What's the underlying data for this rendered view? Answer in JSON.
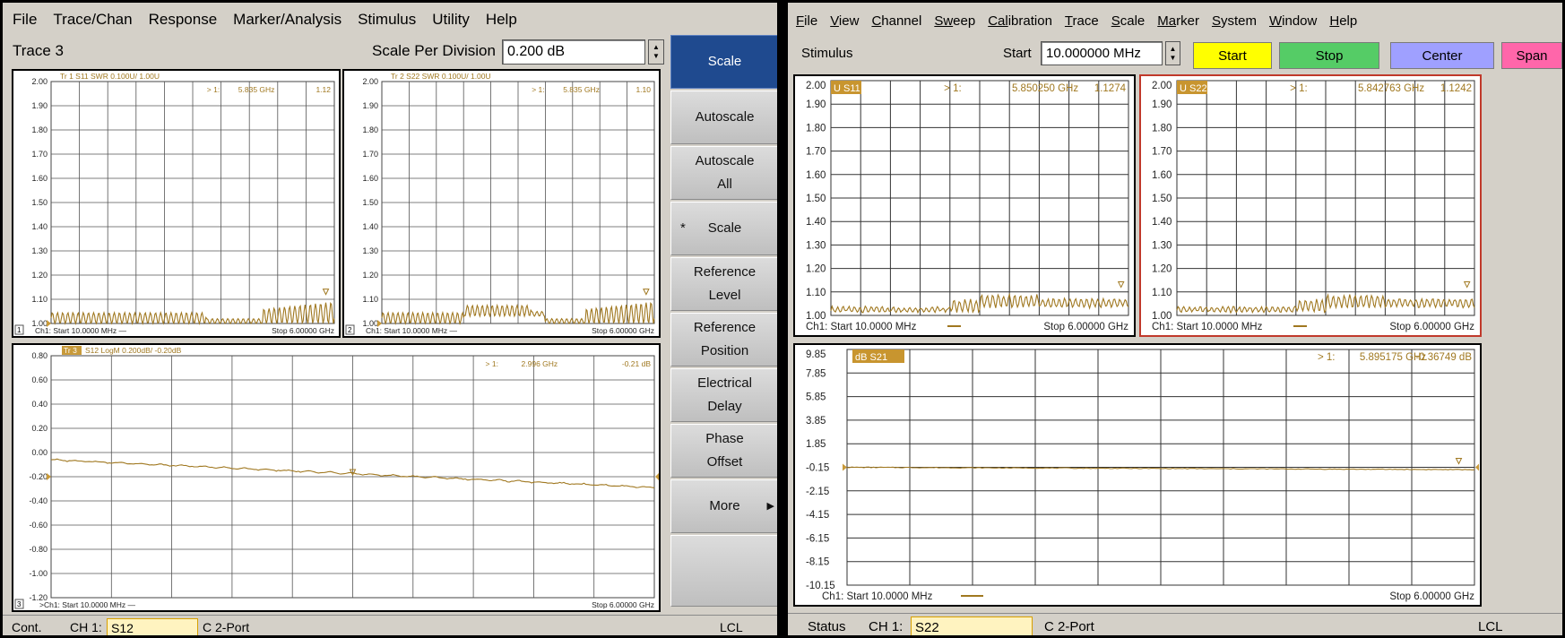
{
  "left": {
    "menu": [
      "File",
      "Trace/Chan",
      "Response",
      "Marker/Analysis",
      "Stimulus",
      "Utility",
      "Help"
    ],
    "active_trace": "Trace 3",
    "scale_label": "Scale Per Division",
    "scale_value": "0.200 dB",
    "softkeys": [
      "Scale",
      "Autoscale",
      "Autoscale|All",
      "Scale",
      "Reference|Level",
      "Reference|Position",
      "Electrical|Delay",
      "Phase|Offset",
      "More",
      ""
    ],
    "status": {
      "mode": "Cont.",
      "channel_label": "CH 1:",
      "param": "S12",
      "port": "C 2-Port",
      "lcl": "LCL"
    },
    "plots": [
      {
        "num": "1",
        "header": "Tr 1  S11 SWR 0.100U/ 1.00U",
        "marker_label": "> 1:",
        "marker_freq": "5.835 GHz",
        "marker_val": "1.12",
        "yticks": [
          "2.00",
          "1.90",
          "1.80",
          "1.70",
          "1.60",
          "1.50",
          "1.40",
          "1.30",
          "1.20",
          "1.10",
          "1.00"
        ],
        "footer_start": "Ch1: Start  10.0000 MHz —",
        "footer_stop": "Stop  6.00000 GHz"
      },
      {
        "num": "2",
        "header": "Tr 2  S22 SWR 0.100U/ 1.00U",
        "marker_label": "> 1:",
        "marker_freq": "5.835 GHz",
        "marker_val": "1.10",
        "yticks": [
          "2.00",
          "1.90",
          "1.80",
          "1.70",
          "1.60",
          "1.50",
          "1.40",
          "1.30",
          "1.20",
          "1.10",
          "1.00"
        ],
        "footer_start": "Ch1: Start  10.0000 MHz —",
        "footer_stop": "Stop  6.00000 GHz"
      },
      {
        "num": "3",
        "tr_tag": "Tr 3",
        "header": "S12 LogM 0.200dB/ -0.20dB",
        "marker_label": "> 1:",
        "marker_freq": "2.996 GHz",
        "marker_val": "-0.21 dB",
        "yticks": [
          "0.80",
          "0.60",
          "0.40",
          "0.20",
          "0.00",
          "-0.20",
          "-0.40",
          "-0.60",
          "-0.80",
          "-1.00",
          "-1.20"
        ],
        "footer_start": ">Ch1: Start  10.0000 MHz —",
        "footer_stop": "Stop  6.00000 GHz"
      }
    ]
  },
  "right": {
    "menu": [
      [
        "F",
        "ile"
      ],
      [
        "V",
        "iew"
      ],
      [
        "C",
        "hannel"
      ],
      [
        "Sw",
        "eep"
      ],
      [
        "Cal",
        "ibration"
      ],
      [
        "T",
        "race"
      ],
      [
        "S",
        "cale"
      ],
      [
        "Ma",
        "rker"
      ],
      [
        "S",
        "ystem"
      ],
      [
        "W",
        "indow"
      ],
      [
        "H",
        "elp"
      ]
    ],
    "stimulus_label": "Stimulus",
    "start_label": "Start",
    "start_value": "10.000000 MHz",
    "buttons": [
      "Start",
      "Stop",
      "Center",
      "Span"
    ],
    "button_colors": [
      "#ffff00",
      "#55cc66",
      "#9fa0ff",
      "#ff66aa"
    ],
    "status": {
      "label": "Status",
      "channel_label": "CH 1:",
      "param": "S22",
      "port": "C 2-Port",
      "lcl": "LCL"
    },
    "plots": [
      {
        "tag": "U S11",
        "marker_label": "> 1:",
        "marker_freq": "5.850250 GHz",
        "marker_val": "1.1274",
        "yticks": [
          "2.00",
          "1.90",
          "1.80",
          "1.70",
          "1.60",
          "1.50",
          "1.40",
          "1.30",
          "1.20",
          "1.10",
          "1.00"
        ],
        "footer_start": "Ch1: Start  10.0000 MHz",
        "footer_stop": "Stop  6.00000 GHz"
      },
      {
        "tag": "U S22",
        "marker_label": "> 1:",
        "marker_freq": "5.842763 GHz",
        "marker_val": "1.1242",
        "yticks": [
          "2.00",
          "1.90",
          "1.80",
          "1.70",
          "1.60",
          "1.50",
          "1.40",
          "1.30",
          "1.20",
          "1.10",
          "1.00"
        ],
        "footer_start": "Ch1: Start  10.0000 MHz",
        "footer_stop": "Stop  6.00000 GHz"
      },
      {
        "tag": "dB S21",
        "marker_label": "> 1:",
        "marker_freq": "5.895175 GHz",
        "marker_val": "-0.36749 dB",
        "yticks": [
          "9.85",
          "7.85",
          "5.85",
          "3.85",
          "1.85",
          "-0.15",
          "-2.15",
          "-4.15",
          "-6.15",
          "-8.15",
          "-10.15"
        ],
        "footer_start": "Ch1: Start  10.0000 MHz",
        "footer_stop": "Stop  6.00000 GHz"
      }
    ]
  },
  "trace_color": "#a07820"
}
